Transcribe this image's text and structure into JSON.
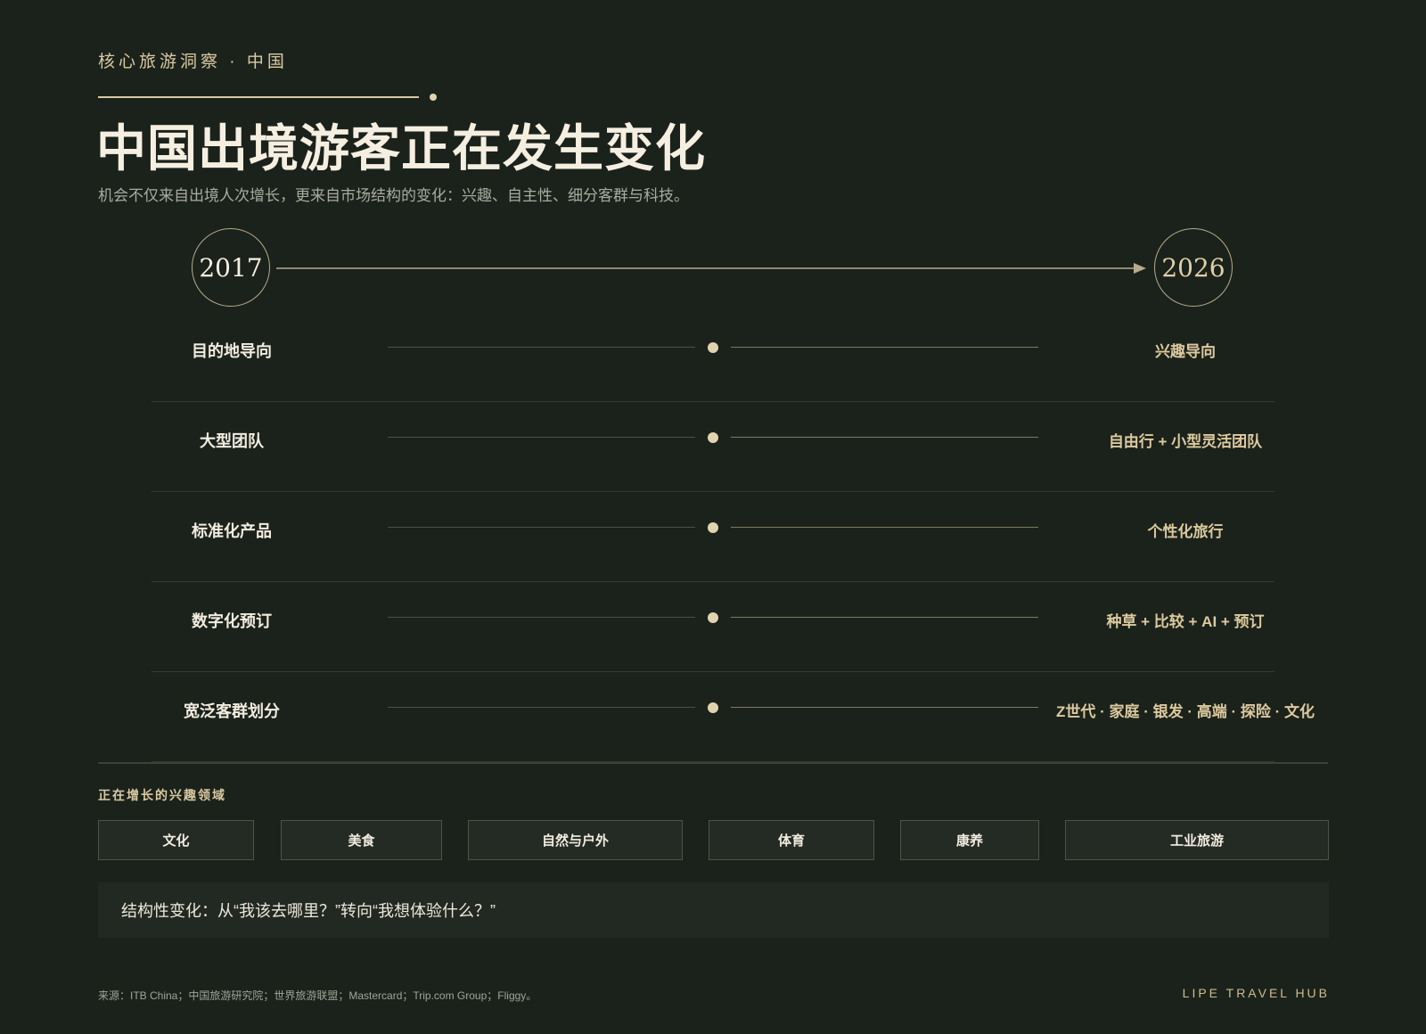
{
  "header": {
    "eyebrow": "核心旅游洞察 · 中国",
    "title": "中国出境游客正在发生变化",
    "subtitle": "机会不仅来自出境人次增长，更来自市场结构的变化：兴趣、自主性、细分客群与科技。"
  },
  "timeline": {
    "start_year": "2017",
    "end_year": "2026"
  },
  "rows": [
    {
      "from": "目的地导向",
      "to": "兴趣导向"
    },
    {
      "from": "大型团队",
      "to": "自由行 + 小型灵活团队"
    },
    {
      "from": "标准化产品",
      "to": "个性化旅行"
    },
    {
      "from": "数字化预订",
      "to": "种草 + 比较 + AI + 预订"
    },
    {
      "from": "宽泛客群划分",
      "to": "Z世代 · 家庭 · 银发 · 高端 · 探险 · 文化"
    }
  ],
  "interests": {
    "label": "正在增长的兴趣领域",
    "tags": [
      "文化",
      "美食",
      "自然与户外",
      "体育",
      "康养",
      "工业旅游"
    ]
  },
  "callout": "结构性变化：从“我该去哪里？”转向“我想体验什么？”",
  "footer": {
    "source": "来源：ITB China；中国旅游研究院；世界旅游联盟；Mastercard；Trip.com Group；Fliggy。",
    "brand": "LIPE TRAVEL HUB"
  },
  "colors": {
    "background": "#1b221b",
    "accent": "#d9c9a3",
    "text": "#f2ece0"
  }
}
